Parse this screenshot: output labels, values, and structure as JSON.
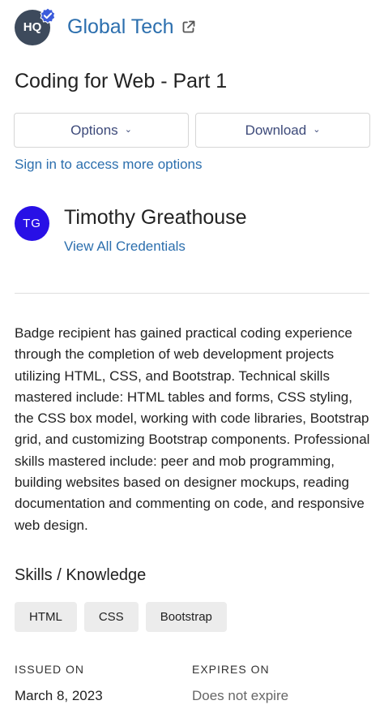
{
  "issuer": {
    "logo_text": "HQ",
    "name": "Global Tech"
  },
  "badge": {
    "title": "Coding for Web - Part 1"
  },
  "actions": {
    "options_label": "Options",
    "download_label": "Download",
    "signin_label": "Sign in to access more options"
  },
  "earner": {
    "initials": "TG",
    "name": "Timothy Greathouse",
    "view_credentials_label": "View All Credentials"
  },
  "description": "Badge recipient has gained practical coding experience through the completion of web development projects utilizing HTML, CSS, and Bootstrap. Technical skills mastered include: HTML tables and forms, CSS styling, the CSS box model, working with code libraries, Bootstrap grid, and customizing Bootstrap components. Professional skills mastered include: peer and mob programming, building websites based on designer mockups, reading documentation and commenting on code, and responsive web design.",
  "skills": {
    "heading": "Skills / Knowledge",
    "items": [
      "HTML",
      "CSS",
      "Bootstrap"
    ]
  },
  "meta": {
    "issued_label": "ISSUED ON",
    "issued_value": "March 8, 2023",
    "expires_label": "EXPIRES ON",
    "expires_value": "Does not expire"
  },
  "colors": {
    "link": "#2c6fae",
    "avatar": "#2810e6",
    "verified": "#3b5bdb"
  },
  "icons": {
    "verified": "verified-check-icon",
    "external": "external-link-icon",
    "chevron": "chevron-down-icon"
  }
}
